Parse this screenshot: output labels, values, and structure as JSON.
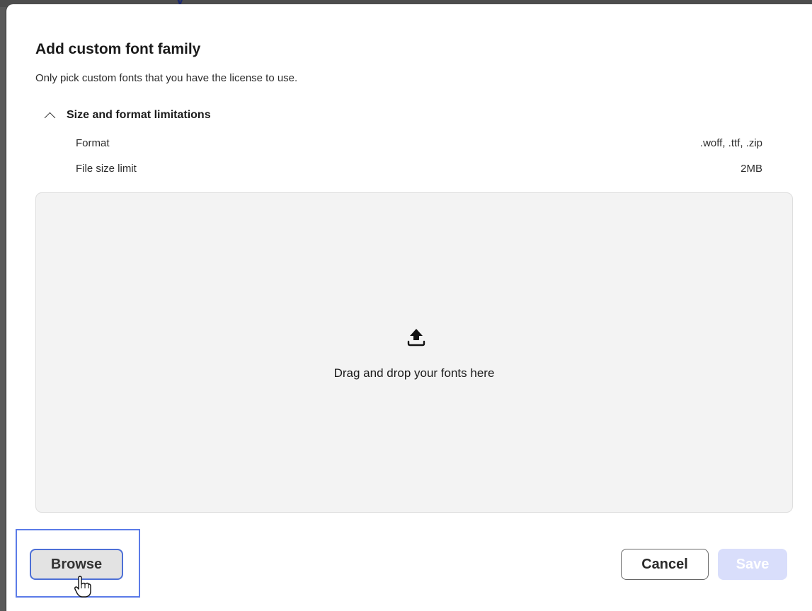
{
  "dialog": {
    "title": "Add custom font family",
    "subtitle": "Only pick custom fonts that you have the license to use."
  },
  "limitations": {
    "header": "Size and format limitations",
    "expanded": true,
    "rows": [
      {
        "label": "Format",
        "value": ".woff, .ttf, .zip"
      },
      {
        "label": "File size limit",
        "value": "2MB"
      }
    ]
  },
  "dropzone": {
    "icon": "upload-icon",
    "text": "Drag and drop your fonts here"
  },
  "footer": {
    "browse_label": "Browse",
    "cancel_label": "Cancel",
    "save_label": "Save",
    "save_disabled": true
  },
  "colors": {
    "highlight": "#5b7be8",
    "save_disabled_bg": "#d9defb"
  }
}
